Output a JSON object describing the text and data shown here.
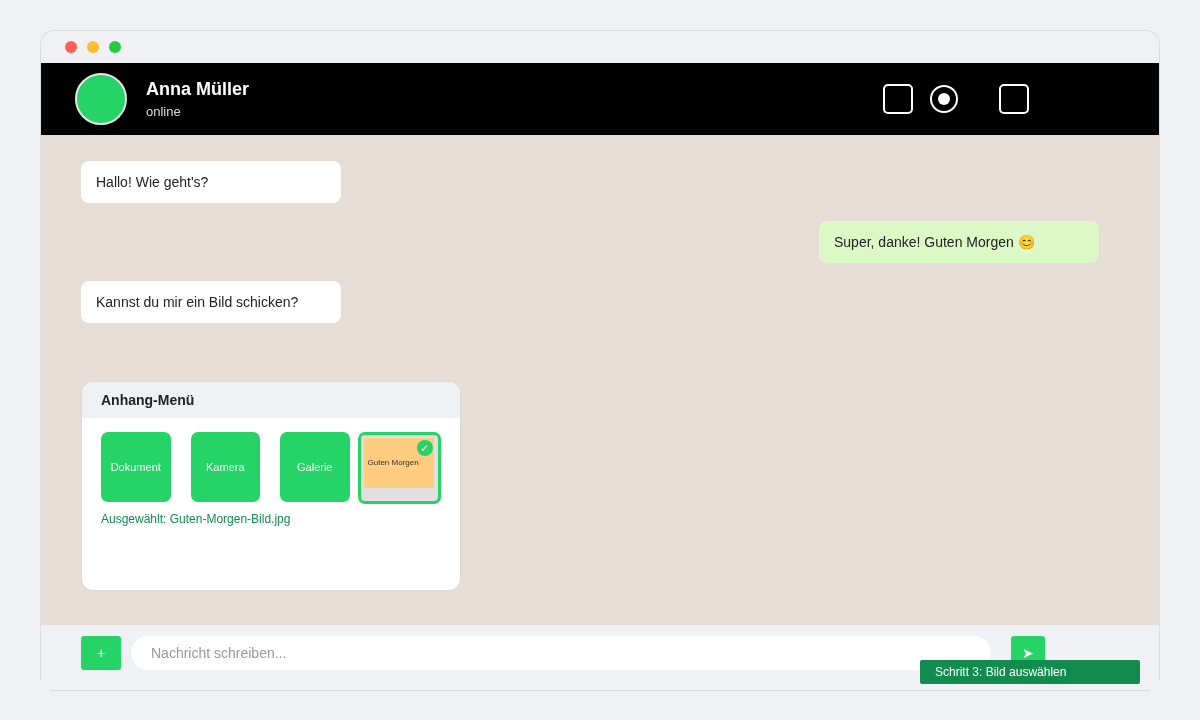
{
  "contact": {
    "name": "Anna Müller",
    "status": "online"
  },
  "messages": [
    {
      "text": "Hallo! Wie geht's?",
      "kind": "received"
    },
    {
      "text": "Super, danke! Guten Morgen 😊",
      "kind": "sent"
    },
    {
      "text": "Kannst du mir ein Bild schicken?",
      "kind": "received"
    }
  ],
  "attachment_menu": {
    "title": "Anhang-Menü",
    "options": [
      {
        "label": "Dokument",
        "kind": "option",
        "selected": false
      },
      {
        "label": "Kamera",
        "kind": "option",
        "selected": false
      },
      {
        "label": "Galerie",
        "kind": "option",
        "selected": false
      },
      {
        "label": "Guten Morgen",
        "kind": "image",
        "selected": true,
        "check": "✓"
      }
    ],
    "selection": "Ausgewählt: Guten-Morgen-Bild.jpg"
  },
  "composer": {
    "attach": "+",
    "placeholder": "Nachricht schreiben...",
    "send": "➤"
  },
  "tooltip": "Schritt 3: Bild auswählen"
}
